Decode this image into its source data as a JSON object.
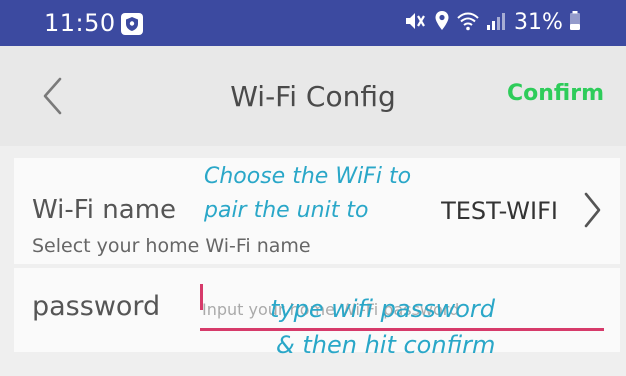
{
  "status_bar": {
    "time": "11:50",
    "battery": "31%",
    "icons": [
      "shield-icon",
      "mute-icon",
      "location-icon",
      "wifi-icon",
      "signal-icon",
      "battery-icon"
    ],
    "background": "#3c4aa0"
  },
  "header": {
    "back_icon": "chevron-left-icon",
    "title": "Wi-Fi Config",
    "confirm_label": "Confirm",
    "confirm_color": "#2ecc5a"
  },
  "wifi": {
    "label": "Wi-Fi name",
    "value": "TEST-WIFI",
    "hint": "Select your home Wi-Fi name",
    "chevron_icon": "chevron-right-icon"
  },
  "password": {
    "label": "password",
    "value": "",
    "placeholder": "Input your home Wi-Fi password"
  },
  "annotations": {
    "wifi_line1": "Choose the WiFi to",
    "wifi_line2": "pair the unit to",
    "pass_line1": "type wifi password",
    "pass_line2": "& then hit confirm",
    "wifi_color": "#2aa7c8",
    "underline_color": "#d63a6a"
  }
}
